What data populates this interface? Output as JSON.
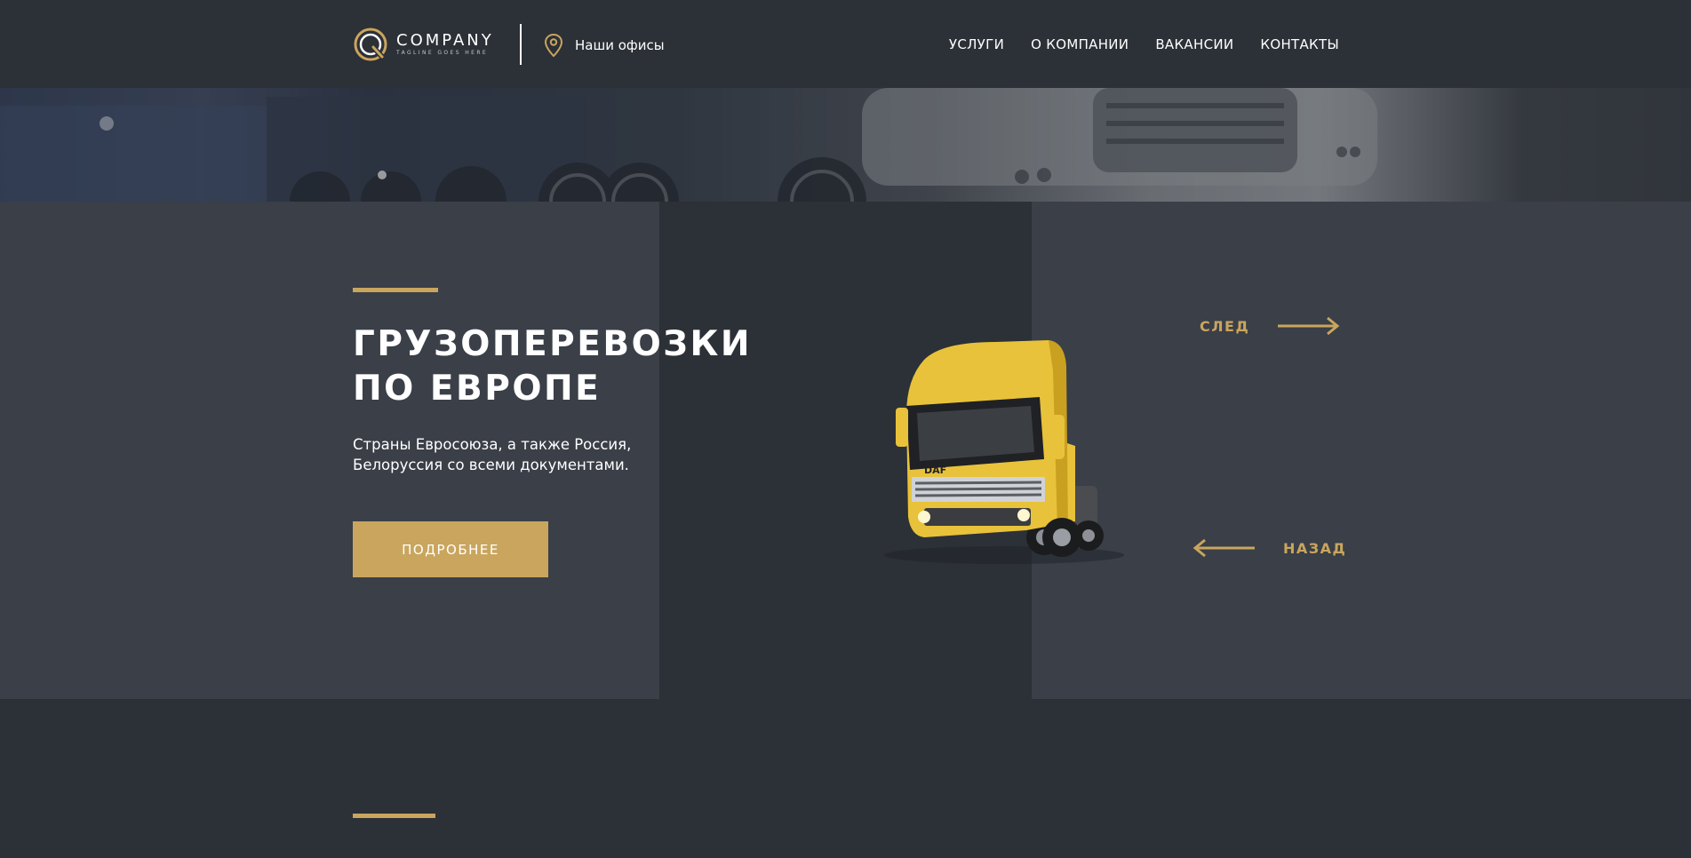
{
  "header": {
    "logo": {
      "name": "COMPANY",
      "tagline": "TAGLINE GOES HERE"
    },
    "offices_label": "Наши офисы",
    "nav": [
      {
        "label": "УСЛУГИ"
      },
      {
        "label": "О КОМПАНИИ"
      },
      {
        "label": "ВАКАНСИИ"
      },
      {
        "label": "КОНТАКТЫ"
      }
    ]
  },
  "hero": {
    "title_line1": "ГРУЗОПЕРЕВОЗКИ",
    "title_line2": "ПО ЕВРОПЕ",
    "subtitle_line1": "Страны Евросоюза, а также Россия,",
    "subtitle_line2": "Белоруссия со всеми документами.",
    "button_label": "ПОДРОБНЕЕ",
    "next_label": "СЛЕД",
    "prev_label": "НАЗАД"
  },
  "colors": {
    "accent": "#c9a55e",
    "background": "#2c3037",
    "panel": "#3a3f48",
    "text": "#ffffff"
  }
}
